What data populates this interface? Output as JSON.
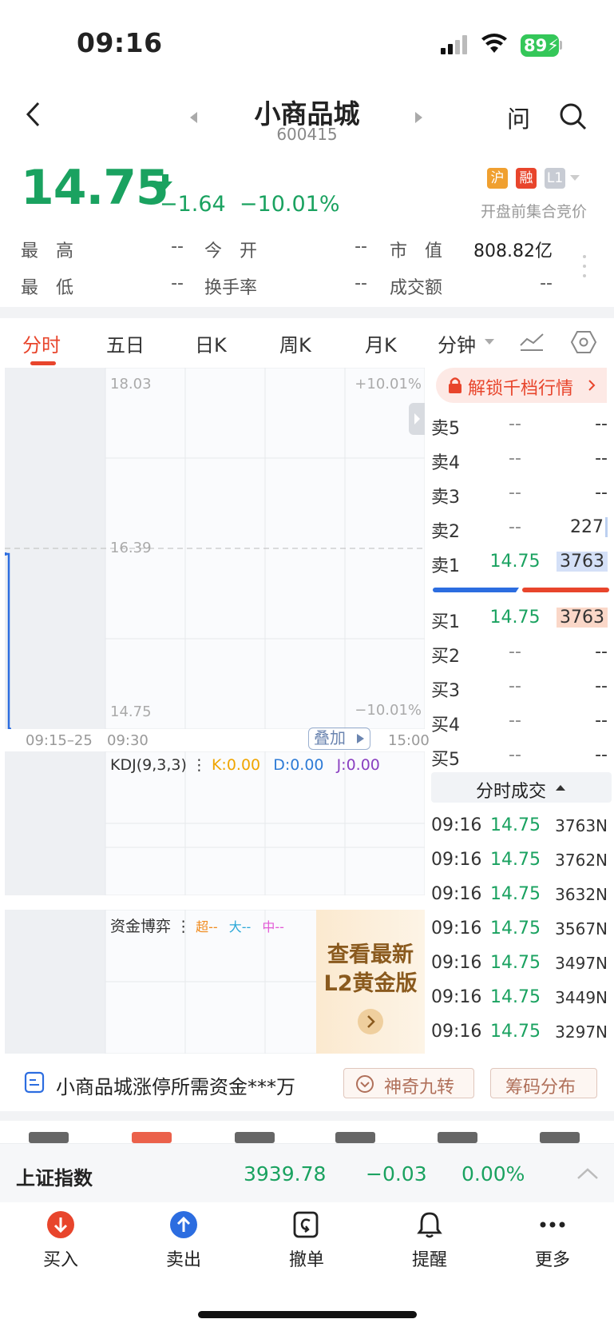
{
  "status_bar": {
    "time": "09:16",
    "battery": "89"
  },
  "header": {
    "title": "小商品城",
    "code": "600415",
    "ask_label": "问"
  },
  "quote": {
    "price": "14.75",
    "change": "−1.64",
    "change_pct": "−10.01%",
    "badges": [
      "沪",
      "融",
      "L1"
    ],
    "phase": "开盘前集合竞价"
  },
  "stats": [
    {
      "label": "最　高",
      "value": "--"
    },
    {
      "label": "今　开",
      "value": "--"
    },
    {
      "label": "市　值",
      "value": "808.82亿"
    },
    {
      "label": "最　低",
      "value": "--"
    },
    {
      "label": "换手率",
      "value": "--"
    },
    {
      "label": "成交额",
      "value": "--"
    }
  ],
  "tabs": [
    {
      "label": "分时",
      "active": true
    },
    {
      "label": "五日"
    },
    {
      "label": "日K"
    },
    {
      "label": "周K"
    },
    {
      "label": "月K"
    },
    {
      "label": "分钟"
    }
  ],
  "chart": {
    "y_top": "18.03",
    "y_mid": "16.39",
    "y_bottom": "14.75",
    "pct_top": "+10.01%",
    "pct_bottom": "−10.01%",
    "x_labels": [
      "09:15–25",
      "09:30",
      "15:00"
    ],
    "overlay_btn": "叠加",
    "kdj_title": "KDJ(9,3,3)",
    "kdj_k": "K:0.00",
    "kdj_d": "D:0.00",
    "kdj_j": "J:0.00",
    "fund_title": "资金博弈",
    "fund_super": "超--",
    "fund_big": "大--",
    "fund_mid": "中--",
    "promo_line1": "查看最新",
    "promo_line2": "L2黄金版"
  },
  "chart_data": {
    "type": "line",
    "x": [
      "09:15",
      "09:16"
    ],
    "y": [
      16.39,
      14.75
    ],
    "ylim": [
      14.75,
      18.03
    ]
  },
  "unlock_banner": "解锁千档行情",
  "order_book": {
    "asks": [
      {
        "label": "卖5",
        "price": "--",
        "vol": "--"
      },
      {
        "label": "卖4",
        "price": "--",
        "vol": "--"
      },
      {
        "label": "卖3",
        "price": "--",
        "vol": "--"
      },
      {
        "label": "卖2",
        "price": "--",
        "vol": "227"
      },
      {
        "label": "卖1",
        "price": "14.75",
        "vol": "3763"
      }
    ],
    "bids": [
      {
        "label": "买1",
        "price": "14.75",
        "vol": "3763"
      },
      {
        "label": "买2",
        "price": "--",
        "vol": "--"
      },
      {
        "label": "买3",
        "price": "--",
        "vol": "--"
      },
      {
        "label": "买4",
        "price": "--",
        "vol": "--"
      },
      {
        "label": "买5",
        "price": "--",
        "vol": "--"
      }
    ]
  },
  "trades_header": "分时成交",
  "trades": [
    {
      "time": "09:16",
      "price": "14.75",
      "vol": "3763N"
    },
    {
      "time": "09:16",
      "price": "14.75",
      "vol": "3762N"
    },
    {
      "time": "09:16",
      "price": "14.75",
      "vol": "3632N"
    },
    {
      "time": "09:16",
      "price": "14.75",
      "vol": "3567N"
    },
    {
      "time": "09:16",
      "price": "14.75",
      "vol": "3497N"
    },
    {
      "time": "09:16",
      "price": "14.75",
      "vol": "3449N"
    },
    {
      "time": "09:16",
      "price": "14.75",
      "vol": "3297N"
    }
  ],
  "info_bar": {
    "text": "小商品城涨停所需资金***万",
    "btn1": "神奇九转",
    "btn2": "筹码分布"
  },
  "index_bar": {
    "name": "上证指数",
    "value": "3939.78",
    "change": "−0.03",
    "pct": "0.00%"
  },
  "bottom_nav": [
    "买入",
    "卖出",
    "撤单",
    "提醒",
    "更多"
  ],
  "colors": {
    "up_red": "#e8452c",
    "down_green": "#1aa260",
    "accent_blue": "#2563eb"
  }
}
